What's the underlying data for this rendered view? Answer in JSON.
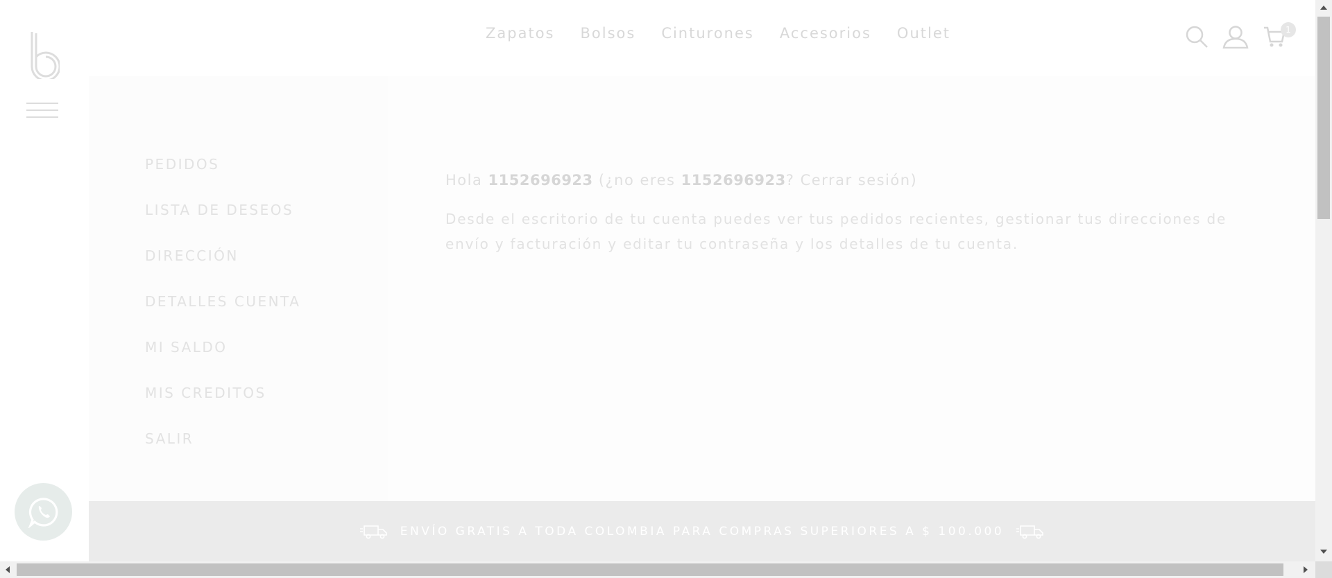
{
  "brand": {
    "logo_icon": "b-logo-icon",
    "menu_icon": "hamburger-icon"
  },
  "nav": {
    "items": [
      {
        "label": "Zapatos"
      },
      {
        "label": "Bolsos"
      },
      {
        "label": "Cinturones"
      },
      {
        "label": "Accesorios"
      },
      {
        "label": "Outlet"
      }
    ]
  },
  "header_icons": {
    "search": "search-icon",
    "account": "user-icon",
    "cart": "cart-icon",
    "cart_count": "1"
  },
  "account_menu": {
    "items": [
      {
        "label": "PEDIDOS"
      },
      {
        "label": "LISTA DE DESEOS"
      },
      {
        "label": "DIRECCIÓN"
      },
      {
        "label": "DETALLES CUENTA"
      },
      {
        "label": "MI SALDO"
      },
      {
        "label": "MIS CREDITOS"
      },
      {
        "label": "SALIR"
      }
    ]
  },
  "dashboard": {
    "hello_prefix": "Hola ",
    "user": "1152696923",
    "not_you_prefix": " (¿no eres ",
    "not_you_suffix": "? ",
    "logout_link": "Cerrar sesión",
    "close_paren": ")",
    "description": "Desde el escritorio de tu cuenta puedes ver tus pedidos recientes, gestionar tus direcciones de envío y facturación y editar tu contraseña y los detalles de tu cuenta."
  },
  "banner": {
    "text": "ENVÍO GRATIS A TODA COLOMBIA PARA COMPRAS SUPERIORES A $ 100.000",
    "icon": "delivery-truck-icon"
  },
  "whatsapp": {
    "icon": "whatsapp-icon"
  },
  "colors": {
    "banner_bg": "#ebebeb",
    "text_faded": "#e0e0e0"
  }
}
